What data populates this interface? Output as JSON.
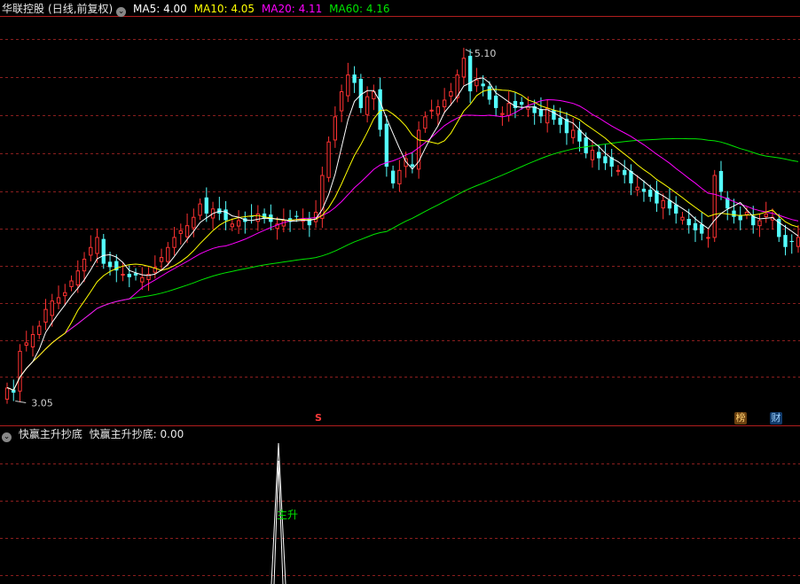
{
  "header": {
    "stock": "华联控股",
    "mode": "(日线,前复权)",
    "ma5": "MA5: 4.00",
    "ma10": "MA10: 4.05",
    "ma20": "MA20: 4.11",
    "ma60": "MA60: 4.16"
  },
  "indicator": {
    "name": "快赢主升抄底",
    "value": "快赢主升抄底: 0.00",
    "signal_label": "主升"
  },
  "markers": {
    "s_label": "S",
    "bang_label": "榜",
    "cai_label": "财"
  },
  "colors": {
    "up": "#ff3232",
    "down": "#54ffff",
    "ma5": "#ffffff",
    "ma10": "#ffff00",
    "ma20": "#ff00ff",
    "ma60": "#00e600",
    "grid": "#8a1e1e",
    "sep": "#b01e1e"
  },
  "chart_data": {
    "type": "candlestick",
    "price_range": [
      2.95,
      5.3
    ],
    "high_label": "5.10",
    "low_label": "3.05",
    "ohlc_close": [
      3.08,
      3.05,
      3.3,
      3.35,
      3.4,
      3.45,
      3.55,
      3.6,
      3.62,
      3.65,
      3.72,
      3.78,
      3.85,
      3.92,
      3.98,
      3.82,
      3.8,
      3.78,
      3.76,
      3.74,
      3.75,
      3.74,
      3.76,
      3.8,
      3.86,
      3.92,
      3.98,
      4.02,
      4.05,
      4.1,
      4.18,
      4.12,
      4.15,
      4.12,
      4.08,
      4.06,
      4.08,
      4.07,
      4.1,
      4.12,
      4.09,
      4.07,
      4.06,
      4.08,
      4.07,
      4.1,
      4.09,
      4.05,
      4.13,
      4.35,
      4.55,
      4.7,
      4.85,
      4.95,
      4.9,
      4.75,
      4.82,
      4.85,
      4.62,
      4.4,
      4.3,
      4.38,
      4.45,
      4.4,
      4.62,
      4.7,
      4.74,
      4.76,
      4.8,
      4.85,
      4.95,
      5.05,
      4.85,
      4.92,
      4.88,
      4.8,
      4.75,
      4.72,
      4.78,
      4.75,
      4.77,
      4.76,
      4.72,
      4.7,
      4.75,
      4.68,
      4.65,
      4.6,
      4.62,
      4.55,
      4.48,
      4.5,
      4.45,
      4.42,
      4.4,
      4.38,
      4.35,
      4.3,
      4.28,
      4.25,
      4.22,
      4.18,
      4.2,
      4.15,
      4.12,
      4.1,
      4.05,
      4.02,
      4.0,
      3.98,
      4.35,
      4.25,
      4.15,
      4.1,
      4.08,
      4.13,
      4.05,
      4.08,
      4.12,
      4.1,
      3.98,
      3.92,
      3.95,
      3.98
    ]
  }
}
